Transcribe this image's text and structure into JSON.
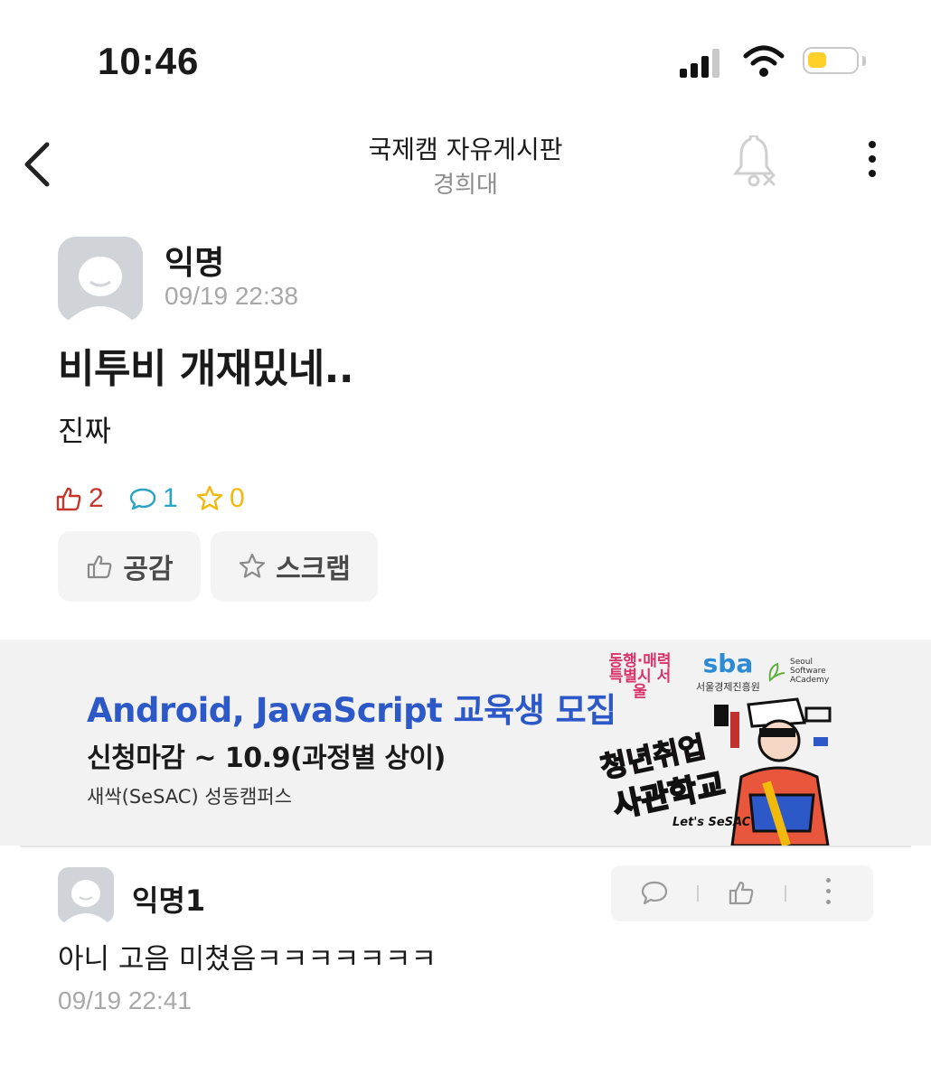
{
  "status_bar": {
    "time": "10:46"
  },
  "header": {
    "title": "국제캠 자유게시판",
    "subtitle": "경희대"
  },
  "post": {
    "author": "익명",
    "timestamp": "09/19 22:38",
    "title": "비투비 개재밌네..",
    "body": "진짜",
    "likes": "2",
    "comments": "1",
    "scraps": "0",
    "like_button": "공감",
    "scrap_button": "스크랩"
  },
  "ad": {
    "headline": "Android, JavaScript 교육생 모집",
    "deadline": "신청마감 ~ 10.9(과정별 상이)",
    "campus": "새싹(SeSAC) 성동캠퍼스",
    "logo_seoul": "동행·매력 특별시 서울",
    "logo_sba": "sba",
    "logo_sba_caption": "서울경제진흥원",
    "logo_ssa": "Seoul Software ACademy",
    "art_text_1": "청년취업",
    "art_text_2": "사관학교",
    "art_text_3": "Let's SeSAC"
  },
  "comments": [
    {
      "author": "익명1",
      "body": "아니 고음 미쳤음ㅋㅋㅋㅋㅋㅋㅋ",
      "timestamp": "09/19 22:41"
    }
  ],
  "colors": {
    "like": "#c6352b",
    "comment": "#2aa3c4",
    "scrap": "#f0b90b",
    "ad_title": "#2c59c7"
  },
  "icons": [
    "back-icon",
    "bell-off-icon",
    "more-icon",
    "thumbs-up-icon",
    "comment-icon",
    "star-icon"
  ]
}
